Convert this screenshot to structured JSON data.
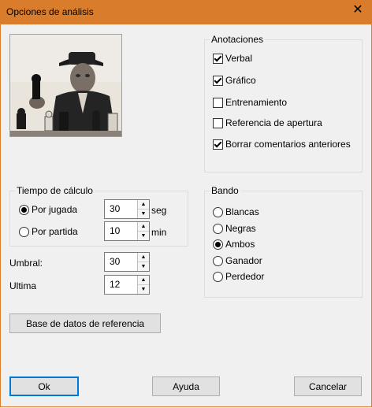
{
  "window": {
    "title": "Opciones de análisis",
    "close_glyph": "✕"
  },
  "photo": {
    "alt": "player-photo"
  },
  "anotaciones": {
    "title": "Anotaciones",
    "items": [
      {
        "label": "Verbal",
        "checked": true
      },
      {
        "label": "Gráfico",
        "checked": true
      },
      {
        "label": "Entrenamiento",
        "checked": false
      },
      {
        "label": "Referencia de apertura",
        "checked": false
      },
      {
        "label": "Borrar comentarios anteriores",
        "checked": true
      }
    ]
  },
  "tiempo": {
    "title": "Tiempo de cálculo",
    "por_jugada": {
      "label": "Por jugada",
      "value": "30",
      "unit": "seg",
      "selected": true
    },
    "por_partida": {
      "label": "Por partida",
      "value": "10",
      "unit": "min",
      "selected": false
    }
  },
  "umbral": {
    "label": "Umbral:",
    "value": "30"
  },
  "ultima": {
    "label": "Ultima",
    "value": "12"
  },
  "bando": {
    "title": "Bando",
    "items": [
      {
        "label": "Blancas",
        "selected": false
      },
      {
        "label": "Negras",
        "selected": false
      },
      {
        "label": "Ambos",
        "selected": true
      },
      {
        "label": "Ganador",
        "selected": false
      },
      {
        "label": "Perdedor",
        "selected": false
      }
    ]
  },
  "buttons": {
    "referencia": "Base de datos de referencia",
    "ok": "Ok",
    "ayuda": "Ayuda",
    "cancelar": "Cancelar"
  },
  "icons": {
    "spin_up": "▲",
    "spin_down": "▼"
  }
}
